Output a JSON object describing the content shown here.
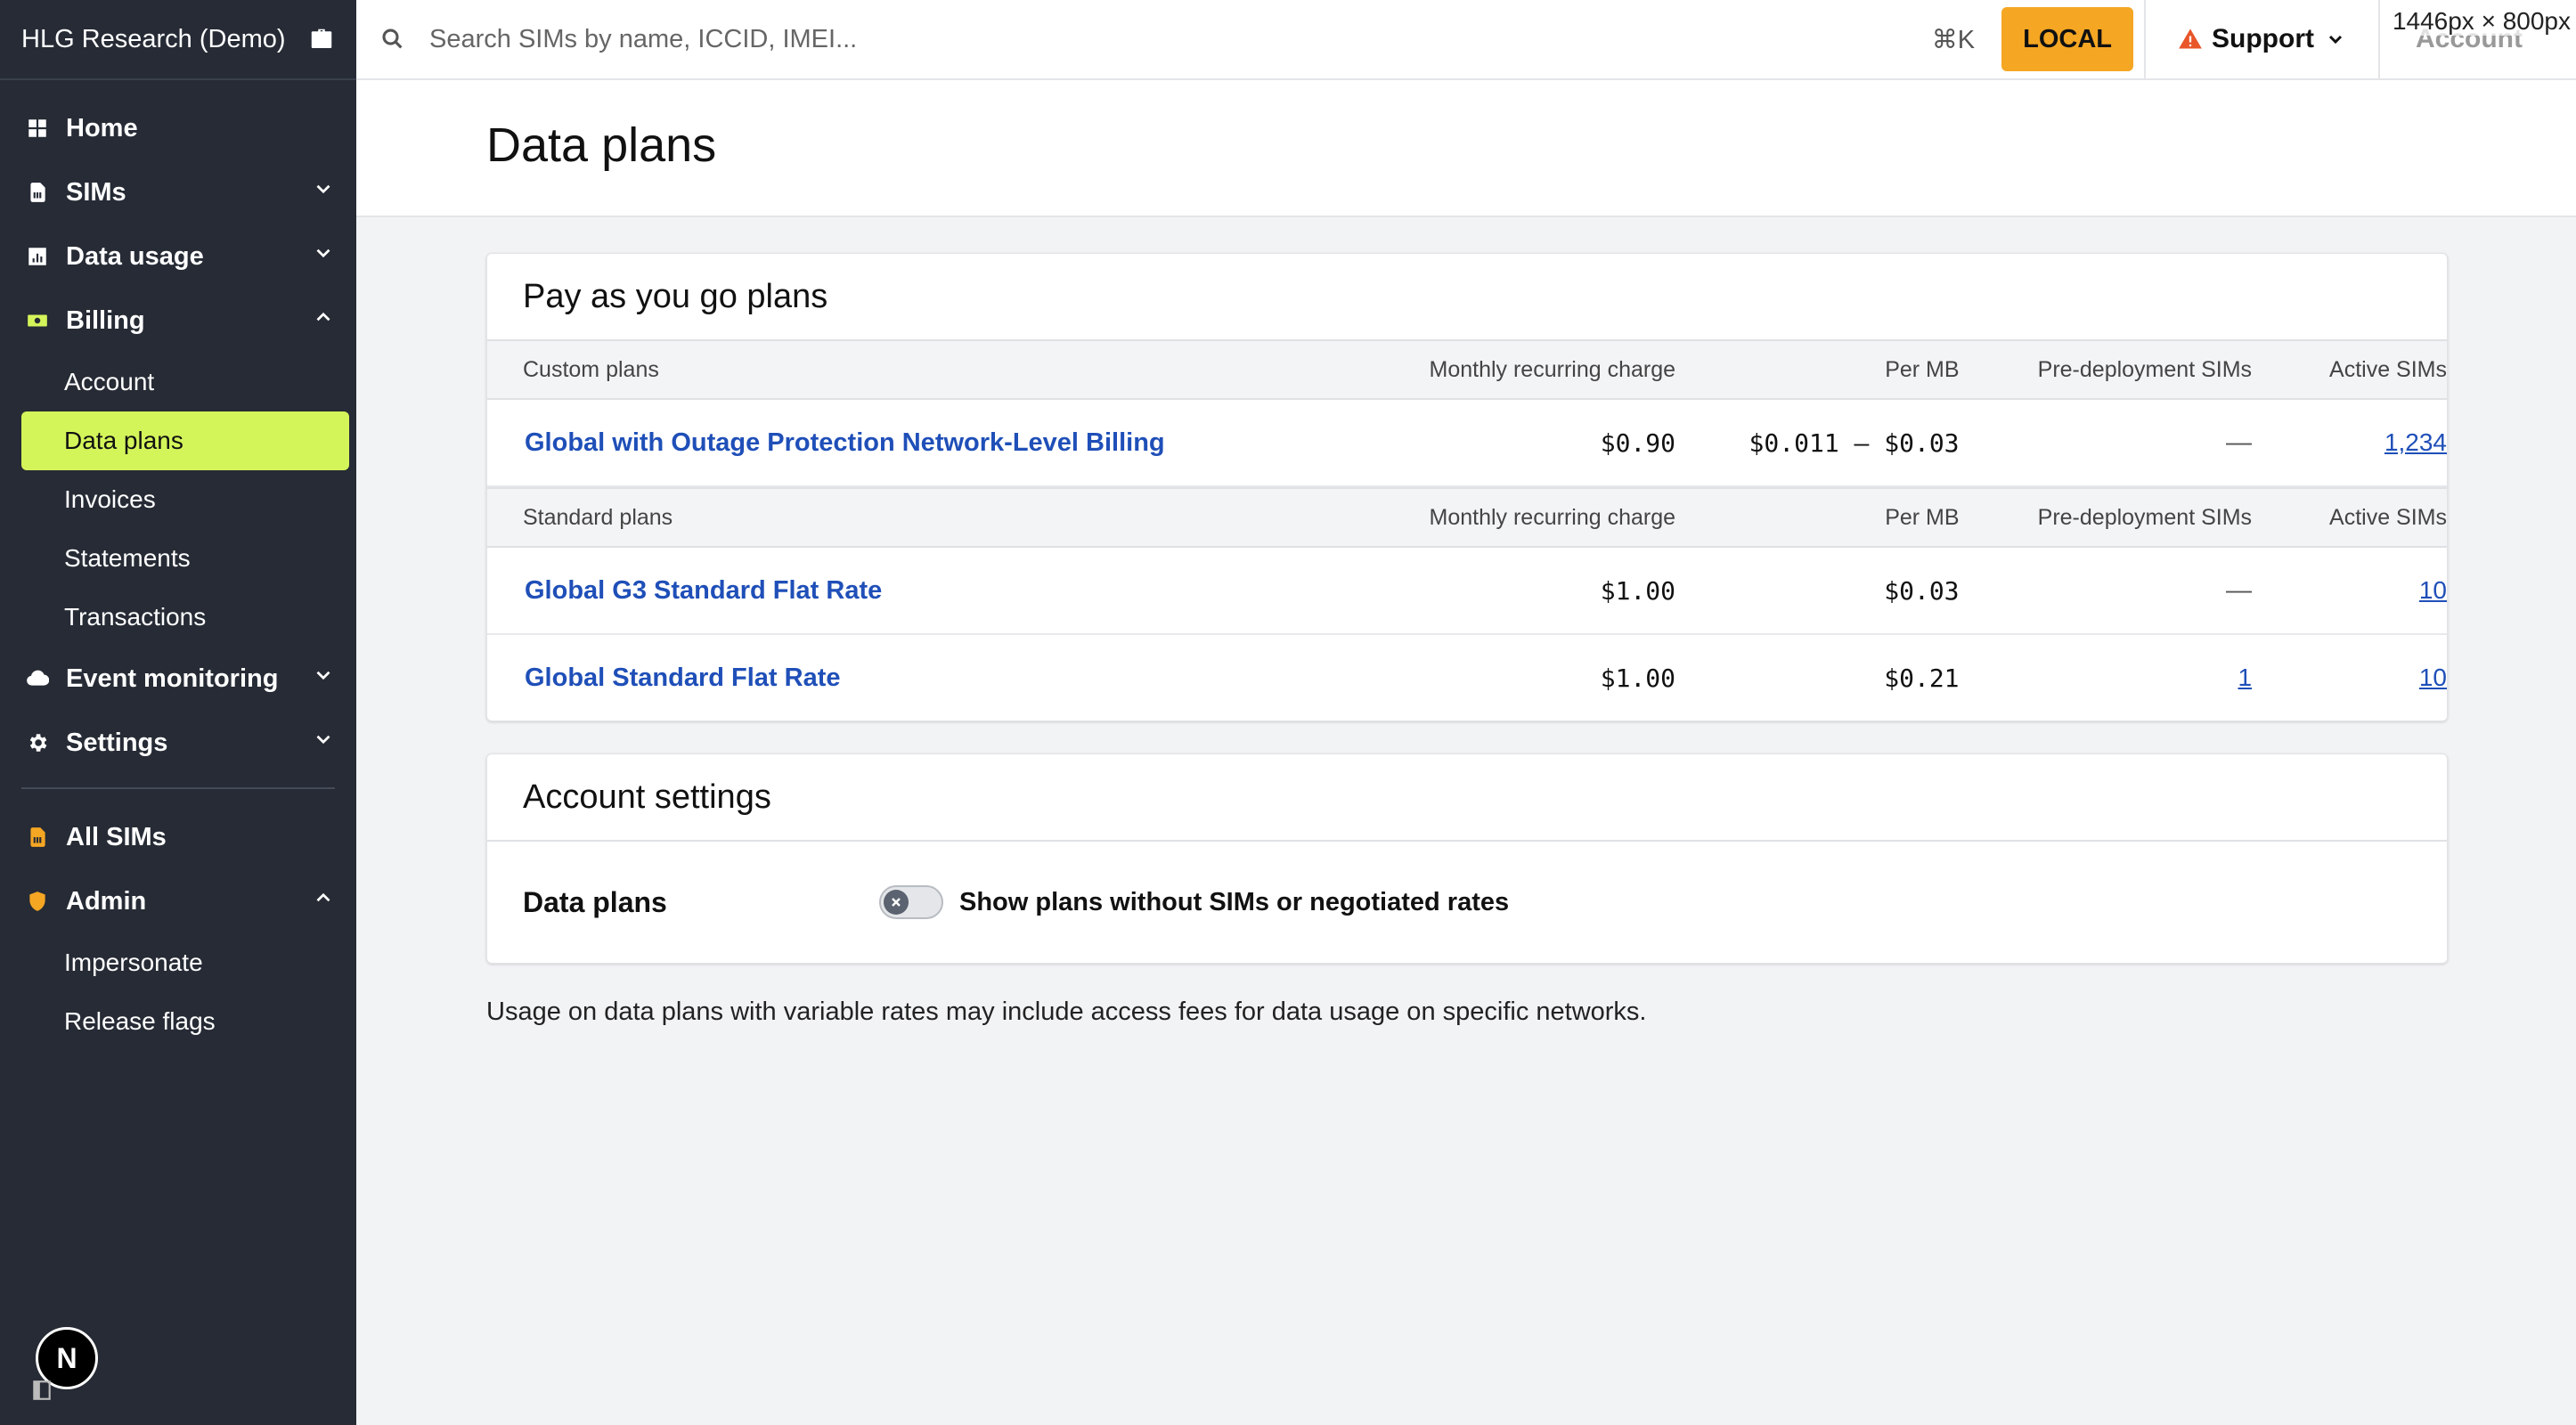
{
  "sidebar": {
    "org_name": "HLG Research (Demo)",
    "items": [
      {
        "label": "Home",
        "icon": "grid-icon"
      },
      {
        "label": "SIMs",
        "icon": "sim-icon"
      },
      {
        "label": "Data usage",
        "icon": "chart-icon"
      },
      {
        "label": "Billing",
        "icon": "money-icon",
        "accent": "#d4f55a"
      }
    ],
    "billing_sub": [
      "Account",
      "Data plans",
      "Invoices",
      "Statements",
      "Transactions"
    ],
    "items2": [
      {
        "label": "Event monitoring",
        "icon": "cloud-icon"
      },
      {
        "label": "Settings",
        "icon": "gear-icon"
      }
    ],
    "items3": [
      {
        "label": "All SIMs",
        "icon": "sim-orange-icon",
        "accent": "#f5a623"
      },
      {
        "label": "Admin",
        "icon": "shield-icon",
        "accent": "#f5a623"
      }
    ],
    "admin_sub": [
      "Impersonate",
      "Release flags"
    ],
    "badge_letter": "N"
  },
  "topbar": {
    "search_placeholder": "Search SIMs by name, ICCID, IMEI...",
    "shortcut": "⌘K",
    "env_label": "LOCAL",
    "support_label": "Support",
    "account_label": "Account",
    "dims_label": "1446px × 800px"
  },
  "page": {
    "title": "Data plans"
  },
  "payg": {
    "title": "Pay as you go plans",
    "custom_headers": [
      "Custom plans",
      "Monthly recurring charge",
      "Per MB",
      "Pre-deployment SIMs",
      "Active SIMs"
    ],
    "custom_rows": [
      {
        "name": "Global with Outage Protection Network-Level Billing",
        "mrc": "$0.90",
        "per_mb": "$0.011 – $0.03",
        "pre": "—",
        "active": "1,234"
      }
    ],
    "standard_headers": [
      "Standard plans",
      "Monthly recurring charge",
      "Per MB",
      "Pre-deployment SIMs",
      "Active SIMs"
    ],
    "standard_rows": [
      {
        "name": "Global G3 Standard Flat Rate",
        "mrc": "$1.00",
        "per_mb": "$0.03",
        "pre": "—",
        "active": "10"
      },
      {
        "name": "Global Standard Flat Rate",
        "mrc": "$1.00",
        "per_mb": "$0.21",
        "pre": "1",
        "active": "10"
      }
    ]
  },
  "account_settings": {
    "title": "Account settings",
    "row_label": "Data plans",
    "toggle_label": "Show plans without SIMs or negotiated rates",
    "toggle_on": false
  },
  "footnote": "Usage on data plans with variable rates may include access fees for data usage on specific networks.",
  "colors": {
    "sidebar_bg": "#262b35",
    "active_bg": "#d4f55a",
    "link": "#1f4fb8",
    "local_btn": "#f5a623"
  }
}
